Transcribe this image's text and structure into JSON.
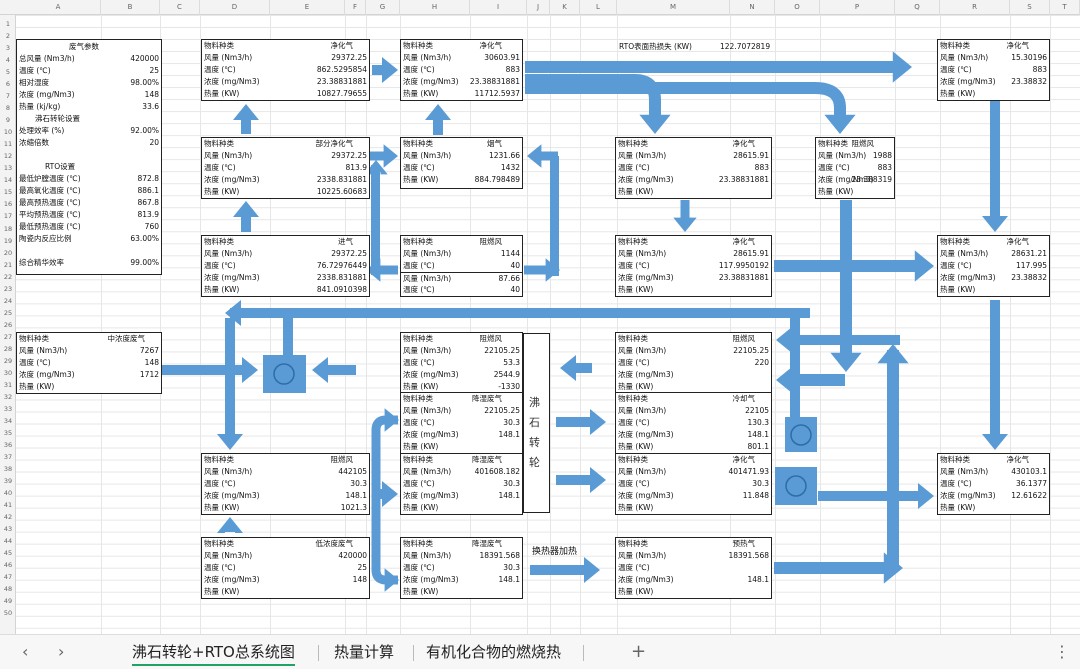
{
  "columns": [
    "A",
    "B",
    "C",
    "D",
    "E",
    "F",
    "G",
    "H",
    "I",
    "J",
    "K",
    "L",
    "M",
    "N",
    "O",
    "P",
    "Q",
    "R",
    "S",
    "T"
  ],
  "rows": [
    "1",
    "2",
    "3",
    "4",
    "5",
    "6",
    "7",
    "8",
    "9",
    "10",
    "11",
    "12",
    "13",
    "14",
    "15",
    "16",
    "17",
    "18",
    "19",
    "20",
    "21",
    "22",
    "23",
    "24",
    "25",
    "26",
    "27",
    "28",
    "29",
    "30",
    "31",
    "32",
    "33",
    "34",
    "35",
    "36",
    "37",
    "38",
    "39",
    "40",
    "41",
    "42",
    "43",
    "44",
    "45",
    "46",
    "47",
    "48",
    "49",
    "50"
  ],
  "params": {
    "title": "废气参数",
    "r3": {
      "l": "总风量 (Nm3/h)",
      "v": "420000"
    },
    "r4": {
      "l": "温度 (℃)",
      "v": "25"
    },
    "r5": {
      "l": "相对湿度",
      "v": "98.00%"
    },
    "r6": {
      "l": "浓度 (mg/Nm3)",
      "v": "148"
    },
    "r7": {
      "l": "热量 (kj/kg)",
      "v": "33.6"
    },
    "wheel_title": "沸石转轮设置",
    "r9": {
      "l": "处理效率 (%)",
      "v": "92.00%"
    },
    "r10": {
      "l": "浓缩倍数",
      "v": "20"
    },
    "rto_title": "RTO设置",
    "r13": {
      "l": "最低炉膛温度 (℃)",
      "v": "872.8"
    },
    "r14": {
      "l": "最高氧化温度 (℃)",
      "v": "886.1"
    },
    "r15": {
      "l": "最高预热温度 (℃)",
      "v": "867.8"
    },
    "r16": {
      "l": "平均预热温度 (℃)",
      "v": "813.9"
    },
    "r17": {
      "l": "最低预热温度 (℃)",
      "v": "760"
    },
    "r18": {
      "l": "陶瓷内反应比例",
      "v": "63.00%"
    },
    "r20": {
      "l": "综合精华效率",
      "v": "99.00%"
    }
  },
  "rto_loss": {
    "label": "RTO表面热损失 (KW)",
    "value": "122.7072819"
  },
  "boxes": {
    "clean1": {
      "type": "净化气",
      "flow": "29372.25",
      "temp": "862.5295854",
      "conc": "23.38831881",
      "heat": "10827.79655"
    },
    "clean2": {
      "type": "净化气",
      "flow": "30603.91",
      "temp": "883",
      "conc": "23.38831881",
      "heat": "11712.5937"
    },
    "clean_tr": {
      "type": "净化气",
      "flow": "15.30196",
      "temp": "883",
      "conc": "23.38832",
      "heat": ""
    },
    "partial": {
      "type": "部分净化气",
      "flow": "29372.25",
      "temp": "813.9",
      "conc": "2338.831881",
      "heat": "10225.60683"
    },
    "flue": {
      "type": "烟气",
      "flow": "1231.66",
      "temp": "1432",
      "heat": "884.798489"
    },
    "clean_m1": {
      "type": "净化气",
      "flow": "28615.91",
      "temp": "883",
      "conc": "23.38831881",
      "heat": ""
    },
    "fire_p": {
      "type": "阻燃风",
      "flow": "1988",
      "temp": "883",
      "conc": "23.388319",
      "heat": ""
    },
    "inlet": {
      "type": "进气",
      "flow": "29372.25",
      "temp": "76.72976449",
      "conc": "2338.831881",
      "heat": "841.0910398"
    },
    "fire_c": {
      "type": "阻燃风",
      "flow": "1144",
      "temp": "40",
      "flow2": "87.66",
      "temp2": "40"
    },
    "clean_m2": {
      "type": "净化气",
      "flow": "28615.91",
      "temp": "117.9950192",
      "conc": "23.38831881",
      "heat": ""
    },
    "clean_r2": {
      "type": "净化气",
      "flow": "28631.21",
      "temp": "117.995",
      "conc": "23.38832",
      "heat": ""
    },
    "mid_waste": {
      "type": "中浓度废气",
      "flow": "7267",
      "temp": "148",
      "conc": "1712",
      "heat": ""
    },
    "fire_h": {
      "type": "阻燃风",
      "flow": "22105.25",
      "temp": "53.3",
      "conc": "2544.9",
      "heat": "-1330"
    },
    "fire_m3": {
      "type": "阻燃风",
      "flow": "22105.25",
      "temp": "220",
      "conc": "",
      "heat": ""
    },
    "cooled": {
      "type": "降湿废气",
      "flow": "22105.25",
      "temp": "30.3",
      "conc": "148.1",
      "heat": ""
    },
    "cooling": {
      "type": "冷却气",
      "flow": "22105",
      "temp": "130.3",
      "conc": "148.1",
      "heat": "801.1"
    },
    "fire_d": {
      "type": "阻燃风",
      "flow": "442105",
      "temp": "30.3",
      "conc": "148.1",
      "heat": "1021.3"
    },
    "dehum": {
      "type": "降湿废气",
      "flow": "401608.182",
      "temp": "30.3",
      "conc": "148.1",
      "heat": ""
    },
    "clean_m4": {
      "type": "净化气",
      "flow": "401471.93",
      "temp": "30.3",
      "conc": "11.848",
      "heat": ""
    },
    "clean_r3": {
      "type": "净化气",
      "flow": "430103.1",
      "temp": "36.1377",
      "conc": "12.61622",
      "heat": ""
    },
    "low_waste": {
      "type": "低浓度废气",
      "flow": "420000",
      "temp": "25",
      "conc": "148",
      "heat": ""
    },
    "dehum2": {
      "type": "降湿废气",
      "flow": "18391.568",
      "temp": "30.3",
      "conc": "148.1",
      "heat": ""
    },
    "preheat": {
      "type": "预热气",
      "flow": "18391.568",
      "temp": "",
      "conc": "148.1",
      "heat": ""
    }
  },
  "labels": {
    "kind": "物料种类",
    "flow": "风量 (Nm3/h)",
    "temp": "温度 (℃)",
    "conc": "浓度 (mg/Nm3)",
    "heat": "热量 (KW)"
  },
  "hx_label": "换热器加热",
  "wheel_chars": [
    "沸",
    "石",
    "转",
    "轮"
  ],
  "tabs": [
    {
      "label": "沸石转轮+RTO总系统图",
      "active": true
    },
    {
      "label": "热量计算"
    },
    {
      "label": "有机化合物的燃烧热"
    }
  ],
  "nav": {
    "prev": "‹",
    "next": "›",
    "add": "+",
    "more": "⋮"
  },
  "arrow_color": "#5b9bd5"
}
